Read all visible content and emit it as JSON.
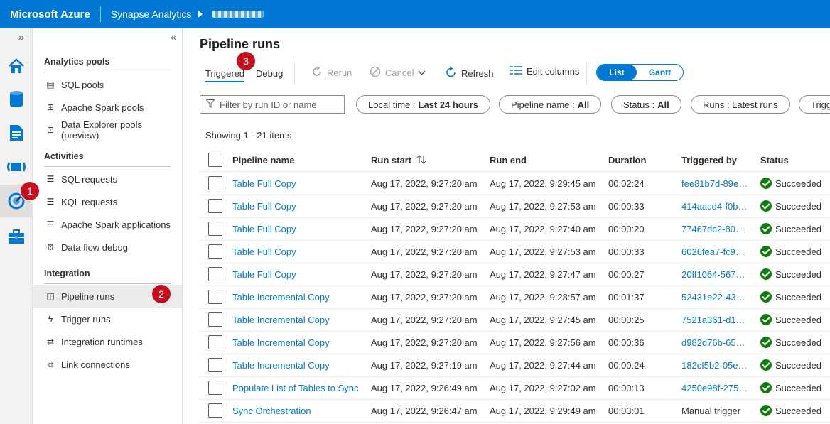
{
  "header": {
    "brand": "Microsoft Azure",
    "service": "Synapse Analytics"
  },
  "nav": {
    "collapse_label": "«",
    "rail_expand_label": "»",
    "sections": [
      {
        "title": "Analytics pools",
        "items": [
          {
            "label": "SQL pools",
            "icon": "sql-pools-icon"
          },
          {
            "label": "Apache Spark pools",
            "icon": "spark-pools-icon"
          },
          {
            "label": "Data Explorer pools (preview)",
            "icon": "data-explorer-icon"
          }
        ]
      },
      {
        "title": "Activities",
        "items": [
          {
            "label": "SQL requests",
            "icon": "sql-requests-icon"
          },
          {
            "label": "KQL requests",
            "icon": "kql-requests-icon"
          },
          {
            "label": "Apache Spark applications",
            "icon": "spark-apps-icon"
          },
          {
            "label": "Data flow debug",
            "icon": "dataflow-debug-icon"
          }
        ]
      },
      {
        "title": "Integration",
        "items": [
          {
            "label": "Pipeline runs",
            "icon": "pipeline-runs-icon",
            "selected": true
          },
          {
            "label": "Trigger runs",
            "icon": "trigger-runs-icon"
          },
          {
            "label": "Integration runtimes",
            "icon": "integration-runtimes-icon"
          },
          {
            "label": "Link connections",
            "icon": "link-connections-icon"
          }
        ]
      }
    ]
  },
  "badges": {
    "one": "1",
    "two": "2",
    "three": "3"
  },
  "page": {
    "title": "Pipeline runs",
    "tabs": {
      "triggered": "Triggered",
      "debug": "Debug"
    },
    "toolbar": {
      "rerun": "Rerun",
      "cancel": "Cancel",
      "refresh": "Refresh",
      "edit_columns": "Edit columns"
    },
    "view_toggle": {
      "list": "List",
      "gantt": "Gantt",
      "selected": "List"
    },
    "filters": {
      "search_placeholder": "Filter by run ID or name",
      "local_time_label": "Local time :",
      "local_time_value": "Last 24 hours",
      "pipeline_name_label": "Pipeline name :",
      "pipeline_name_value": "All",
      "status_label": "Status :",
      "status_value": "All",
      "runs_label": "Runs : Latest runs",
      "trigger_label": "Trigg"
    },
    "showing": "Showing 1 - 21 items",
    "columns": {
      "pipeline_name": "Pipeline name",
      "run_start": "Run start",
      "run_end": "Run end",
      "duration": "Duration",
      "triggered_by": "Triggered by",
      "status": "Status"
    },
    "rows": [
      {
        "pipeline": "Table Full Copy",
        "start": "Aug 17, 2022, 9:27:20 am",
        "end": "Aug 17, 2022, 9:29:45 am",
        "duration": "00:02:24",
        "triggered_by": "fee81b7d-89e…",
        "trigger_link": true,
        "status": "Succeeded"
      },
      {
        "pipeline": "Table Full Copy",
        "start": "Aug 17, 2022, 9:27:20 am",
        "end": "Aug 17, 2022, 9:27:53 am",
        "duration": "00:00:33",
        "triggered_by": "414aacd4-f0b…",
        "trigger_link": true,
        "status": "Succeeded"
      },
      {
        "pipeline": "Table Full Copy",
        "start": "Aug 17, 2022, 9:27:20 am",
        "end": "Aug 17, 2022, 9:27:40 am",
        "duration": "00:00:20",
        "triggered_by": "77467dc2-80…",
        "trigger_link": true,
        "status": "Succeeded"
      },
      {
        "pipeline": "Table Full Copy",
        "start": "Aug 17, 2022, 9:27:20 am",
        "end": "Aug 17, 2022, 9:27:53 am",
        "duration": "00:00:33",
        "triggered_by": "6026fea7-fc9…",
        "trigger_link": true,
        "status": "Succeeded"
      },
      {
        "pipeline": "Table Full Copy",
        "start": "Aug 17, 2022, 9:27:20 am",
        "end": "Aug 17, 2022, 9:27:47 am",
        "duration": "00:00:27",
        "triggered_by": "20ff1064-567…",
        "trigger_link": true,
        "status": "Succeeded"
      },
      {
        "pipeline": "Table Incremental Copy",
        "start": "Aug 17, 2022, 9:27:20 am",
        "end": "Aug 17, 2022, 9:28:57 am",
        "duration": "00:01:37",
        "triggered_by": "52431e22-43…",
        "trigger_link": true,
        "status": "Succeeded"
      },
      {
        "pipeline": "Table Incremental Copy",
        "start": "Aug 17, 2022, 9:27:20 am",
        "end": "Aug 17, 2022, 9:27:45 am",
        "duration": "00:00:25",
        "triggered_by": "7521a361-d1…",
        "trigger_link": true,
        "status": "Succeeded"
      },
      {
        "pipeline": "Table Incremental Copy",
        "start": "Aug 17, 2022, 9:27:20 am",
        "end": "Aug 17, 2022, 9:27:56 am",
        "duration": "00:00:36",
        "triggered_by": "d982d76b-65…",
        "trigger_link": true,
        "status": "Succeeded"
      },
      {
        "pipeline": "Table Incremental Copy",
        "start": "Aug 17, 2022, 9:27:19 am",
        "end": "Aug 17, 2022, 9:27:44 am",
        "duration": "00:00:24",
        "triggered_by": "182cf5b2-05e…",
        "trigger_link": true,
        "status": "Succeeded"
      },
      {
        "pipeline": "Populate List of Tables to Sync",
        "start": "Aug 17, 2022, 9:26:49 am",
        "end": "Aug 17, 2022, 9:27:02 am",
        "duration": "00:00:13",
        "triggered_by": "4250e98f-275…",
        "trigger_link": true,
        "status": "Succeeded"
      },
      {
        "pipeline": "Sync Orchestration",
        "start": "Aug 17, 2022, 9:26:47 am",
        "end": "Aug 17, 2022, 9:29:49 am",
        "duration": "00:03:01",
        "triggered_by": "Manual trigger",
        "trigger_link": false,
        "status": "Succeeded"
      }
    ]
  },
  "colors": {
    "accent": "#0078d4",
    "success": "#107c10",
    "badge": "#c50f1f"
  }
}
